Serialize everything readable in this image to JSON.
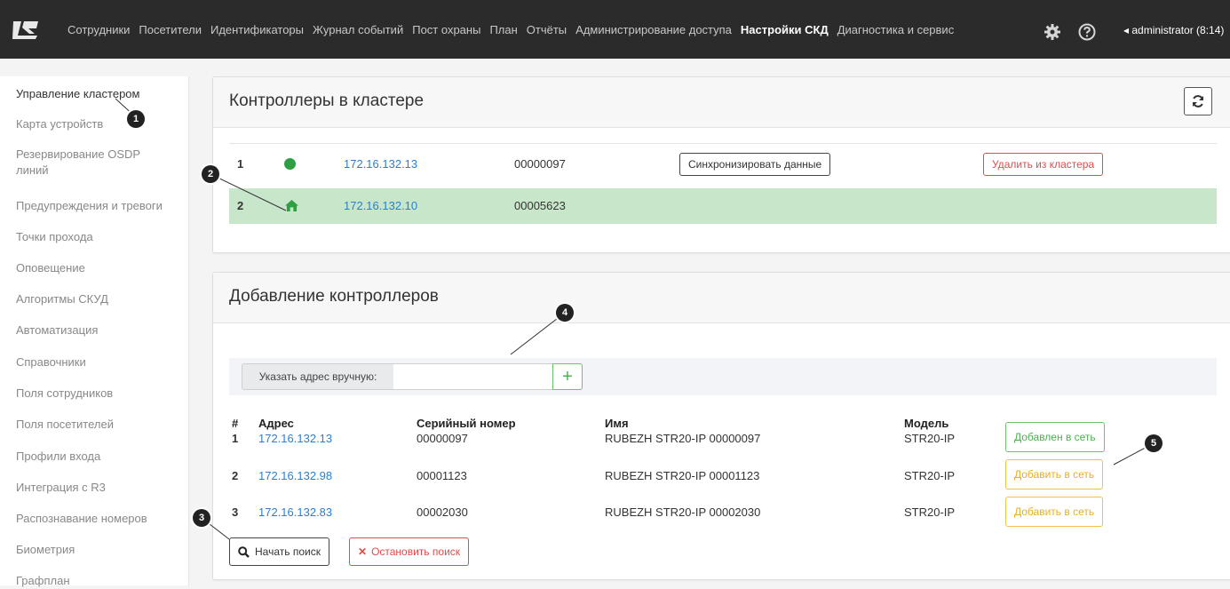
{
  "nav": {
    "items": [
      "Сотрудники",
      "Посетители",
      "Идентификаторы",
      "Журнал событий",
      "Пост охраны",
      "План",
      "Отчёты",
      "Администрирование доступа",
      "Настройки СКД",
      "Диагностика и сервис"
    ],
    "active_index": 8,
    "user": "◂ administrator (8:14)"
  },
  "sidebar": {
    "items": [
      "Управление кластером",
      "Карта устройств",
      "Резервирование OSDP линий",
      "Предупреждения и тревоги",
      "Точки прохода",
      "Оповещение",
      "Алгоритмы СКУД",
      "Автоматизация",
      "Справочники",
      "Поля сотрудников",
      "Поля посетителей",
      "Профили входа",
      "Интеграция с R3",
      "Распознавание номеров",
      "Биометрия",
      "Графплан"
    ],
    "active_index": 0
  },
  "cluster": {
    "title": "Контроллеры в кластере",
    "rows": [
      {
        "num": "1",
        "status": "online",
        "ip": "172.16.132.13",
        "serial": "00000097",
        "sync_label": "Синхронизировать данные",
        "remove_label": "Удалить из кластера"
      },
      {
        "num": "2",
        "status": "home",
        "ip": "172.16.132.10",
        "serial": "00005623"
      }
    ]
  },
  "add": {
    "title": "Добавление контроллеров",
    "manual_label": "Указать адрес вручную:",
    "manual_value": "",
    "headers": [
      "#",
      "Адрес",
      "Серийный номер",
      "Имя",
      "Модель"
    ],
    "rows": [
      {
        "num": "1",
        "ip": "172.16.132.13",
        "serial": "00000097",
        "name": "RUBEZH STR20-IP 00000097",
        "model": "STR20-IP",
        "action": "Добавлен в сеть",
        "state": "added"
      },
      {
        "num": "2",
        "ip": "172.16.132.98",
        "serial": "00001123",
        "name": "RUBEZH STR20-IP 00001123",
        "model": "STR20-IP",
        "action": "Добавить в сеть",
        "state": "new"
      },
      {
        "num": "3",
        "ip": "172.16.132.83",
        "serial": "00002030",
        "name": "RUBEZH STR20-IP 00002030",
        "model": "STR20-IP",
        "action": "Добавить в сеть",
        "state": "new"
      }
    ],
    "start_search": "Начать поиск",
    "stop_search": "Остановить поиск"
  },
  "callouts": [
    "1",
    "2",
    "3",
    "4",
    "5"
  ],
  "colors": {
    "topbar": "#2b2b2b",
    "home_row": "#c8e6c9",
    "online": "#2ea043",
    "link": "#2a7fd1",
    "danger": "#e04b4b",
    "success": "#4caf50",
    "warning": "#e8b020"
  }
}
